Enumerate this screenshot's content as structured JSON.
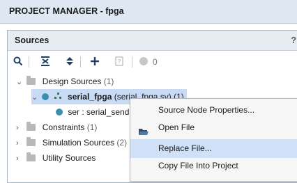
{
  "window": {
    "title": "PROJECT MANAGER - fpga"
  },
  "panel": {
    "title": "Sources",
    "help": "?"
  },
  "toolbar": {
    "icons": [
      "search-icon",
      "collapse-all-icon",
      "expand-all-icon",
      "add-icon",
      "properties-icon",
      "status-dot-icon"
    ],
    "count": "0"
  },
  "tree": {
    "design_sources": {
      "label": "Design Sources",
      "count": "(1)"
    },
    "top_module": {
      "name": "serial_fpga",
      "detail": "(serial_fpga.sv) (1)"
    },
    "child": {
      "label": "ser : serial_send"
    },
    "constraints": {
      "label": "Constraints",
      "count": "(1)"
    },
    "simulation_sources": {
      "label": "Simulation Sources",
      "count": "(2)"
    },
    "utility_sources": {
      "label": "Utility Sources"
    }
  },
  "context_menu": {
    "items": [
      {
        "label": "Source Node Properties..."
      },
      {
        "label": "Open File",
        "icon": "folder-open-icon"
      },
      {
        "label": "Replace File..."
      },
      {
        "label": "Copy File Into Project"
      }
    ]
  },
  "colors": {
    "header": "#dfe8f2",
    "selection": "#c8daf4",
    "hover": "#cfe0f7",
    "accent": "#3a8fb0"
  }
}
